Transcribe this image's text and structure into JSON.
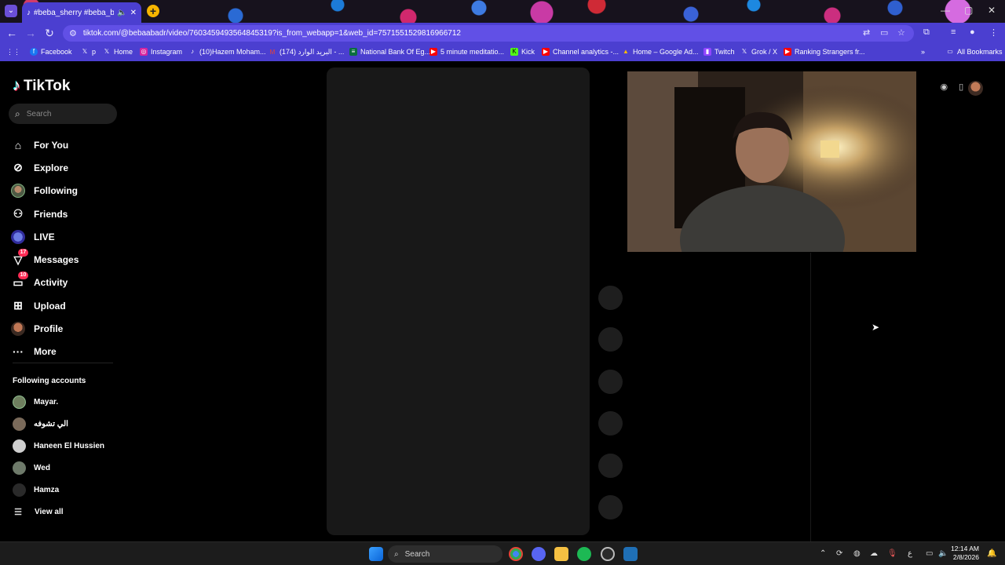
{
  "browser": {
    "tab_title": "#beba_sherry #beba_badr",
    "new_tab_symbol": "+",
    "url": "tiktok.com/@bebaabadr/video/7603459493564845319?is_from_webapp=1&web_id=7571551529816966712",
    "bookmarks": [
      {
        "label": "Facebook",
        "color": "#1877f2",
        "glyph": "f"
      },
      {
        "label": "p",
        "color": "#000000",
        "glyph": "X"
      },
      {
        "label": "Home",
        "color": "#000000",
        "glyph": "X"
      },
      {
        "label": "Instagram",
        "color": "#d6249f",
        "glyph": "◎"
      },
      {
        "label": "(10)Hazem Moham...",
        "color": "#000000",
        "glyph": "♪"
      },
      {
        "label": "(174) البريد الوارد - ...",
        "color": "#ea4335",
        "glyph": "M"
      },
      {
        "label": "National Bank Of Eg...",
        "color": "#0b6e3f",
        "glyph": "≡"
      },
      {
        "label": "5 minute meditatio...",
        "color": "#ff0000",
        "glyph": "▶"
      },
      {
        "label": "Kick",
        "color": "#53fc18",
        "glyph": "K"
      },
      {
        "label": "Channel analytics -...",
        "color": "#ff0000",
        "glyph": "▶"
      },
      {
        "label": "Home – Google Ad...",
        "color": "#fbbc04",
        "glyph": "▲"
      },
      {
        "label": "Twitch",
        "color": "#9146ff",
        "glyph": "▮"
      },
      {
        "label": "Grok / X",
        "color": "#000000",
        "glyph": "X"
      },
      {
        "label": "Ranking Strangers fr...",
        "color": "#ff0000",
        "glyph": "▶"
      }
    ],
    "all_bookmarks": "All Bookmarks"
  },
  "tiktok": {
    "logo_text": "TikTok",
    "search_placeholder": "Search",
    "nav": [
      {
        "label": "For You",
        "icon": "home-icon"
      },
      {
        "label": "Explore",
        "icon": "compass-icon"
      },
      {
        "label": "Following",
        "icon": "following-avatar-icon"
      },
      {
        "label": "Friends",
        "icon": "friends-icon"
      },
      {
        "label": "LIVE",
        "icon": "live-icon"
      },
      {
        "label": "Messages",
        "icon": "messages-icon",
        "badge": "17"
      },
      {
        "label": "Activity",
        "icon": "activity-icon",
        "badge": "10"
      },
      {
        "label": "Upload",
        "icon": "upload-icon"
      },
      {
        "label": "Profile",
        "icon": "profile-avatar-icon"
      },
      {
        "label": "More",
        "icon": "more-icon"
      }
    ],
    "following_title": "Following accounts",
    "accounts": [
      {
        "name": "Mayar.",
        "color": "#6f7f5f"
      },
      {
        "name": "الي تشوفه",
        "color": "#7a6a5a"
      },
      {
        "name": "Haneen El Hussien",
        "color": "#cfcfcf"
      },
      {
        "name": "Wed",
        "color": "#6e7a6a"
      },
      {
        "name": "Hamza",
        "color": "#2a2a2a"
      }
    ],
    "view_all": "View all"
  },
  "taskbar": {
    "search_label": "Search",
    "time": "12:14 AM",
    "date": "2/8/2026",
    "lang": "ع"
  }
}
